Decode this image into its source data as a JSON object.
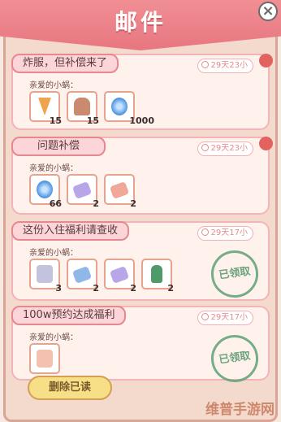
{
  "header": {
    "title": "邮件"
  },
  "mails": [
    {
      "title": "炸服，但补偿来了",
      "time": "29天23小",
      "greeting": "亲爱的小蜗：",
      "items": [
        {
          "icon": "pizza-icon",
          "qty": "15"
        },
        {
          "icon": "bread-icon",
          "qty": "15"
        },
        {
          "icon": "blue-swirl-icon",
          "qty": "1000"
        }
      ],
      "unread": true,
      "claimed": false
    },
    {
      "title": "问题补偿",
      "time": "29天23小",
      "greeting": "亲爱的小蜗：",
      "items": [
        {
          "icon": "blue-swirl-icon",
          "qty": "66"
        },
        {
          "icon": "purple-ticket-icon",
          "qty": "2"
        },
        {
          "icon": "pink-ticket-icon",
          "qty": "2"
        }
      ],
      "unread": true,
      "claimed": false
    },
    {
      "title": "这份入住福利请查收",
      "time": "29天17小",
      "greeting": "亲爱的小蜗：",
      "items": [
        {
          "icon": "gift-box-icon",
          "qty": "3"
        },
        {
          "icon": "blue-ticket-icon",
          "qty": "2"
        },
        {
          "icon": "purple-ticket-icon",
          "qty": "2"
        },
        {
          "icon": "green-bottle-icon",
          "qty": "2"
        }
      ],
      "unread": false,
      "claimed": true,
      "stamp": "已领取"
    },
    {
      "title": "100w预约达成福利",
      "time": "29天17小",
      "greeting": "亲爱的小蜗：",
      "items": [
        {
          "icon": "gift-bag-icon",
          "qty": ""
        }
      ],
      "unread": false,
      "claimed": true,
      "stamp": "已领取"
    }
  ],
  "footer": {
    "delete_label": "删除已读"
  },
  "watermark": "维普手游网",
  "colors": {
    "header": "#e8767f",
    "accent_red": "#e1625e",
    "stamp_green": "#66a67b",
    "button_yellow": "#f6df87"
  }
}
